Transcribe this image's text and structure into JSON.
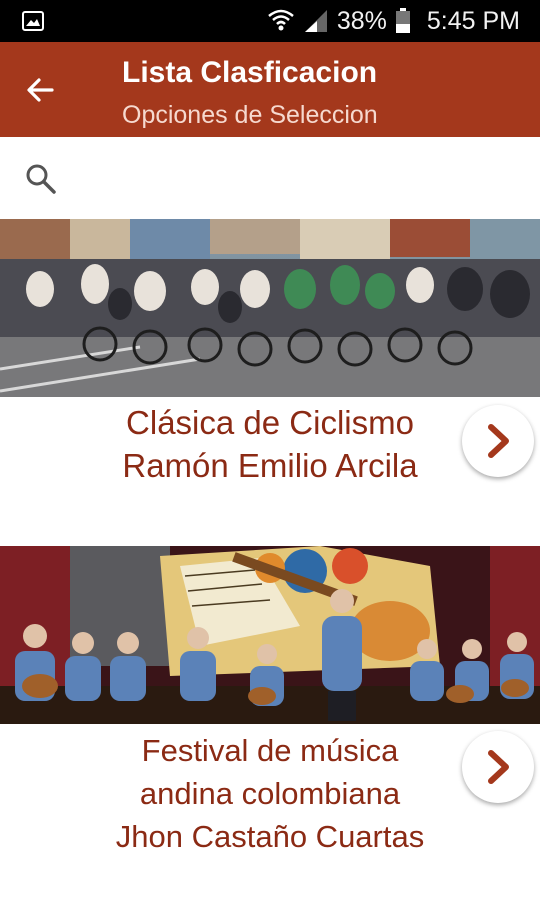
{
  "status_bar": {
    "battery_percent": "38%",
    "time": "5:45 PM",
    "icons": [
      "gallery-icon",
      "wifi-icon",
      "signal-icon",
      "battery-icon"
    ]
  },
  "app_bar": {
    "title": "Lista Clasficacion",
    "subtitle": "Opciones de Seleccion",
    "back_icon": "arrow-back-icon",
    "background": "#a4381c"
  },
  "search": {
    "icon": "search-icon",
    "value": ""
  },
  "cards": [
    {
      "title_lines": [
        "Clásica de Ciclismo",
        "Ramón Emilio Arcila"
      ],
      "image": "cyclists-race-photo",
      "action_icon": "chevron-right-icon"
    },
    {
      "title_lines": [
        "Festival de música",
        "andina colombiana",
        "Jhon Castaño Cuartas"
      ],
      "image": "andean-music-stage-photo",
      "action_icon": "chevron-right-icon"
    }
  ],
  "colors": {
    "title_text": "#8b2a14",
    "chevron": "#a4381c"
  }
}
